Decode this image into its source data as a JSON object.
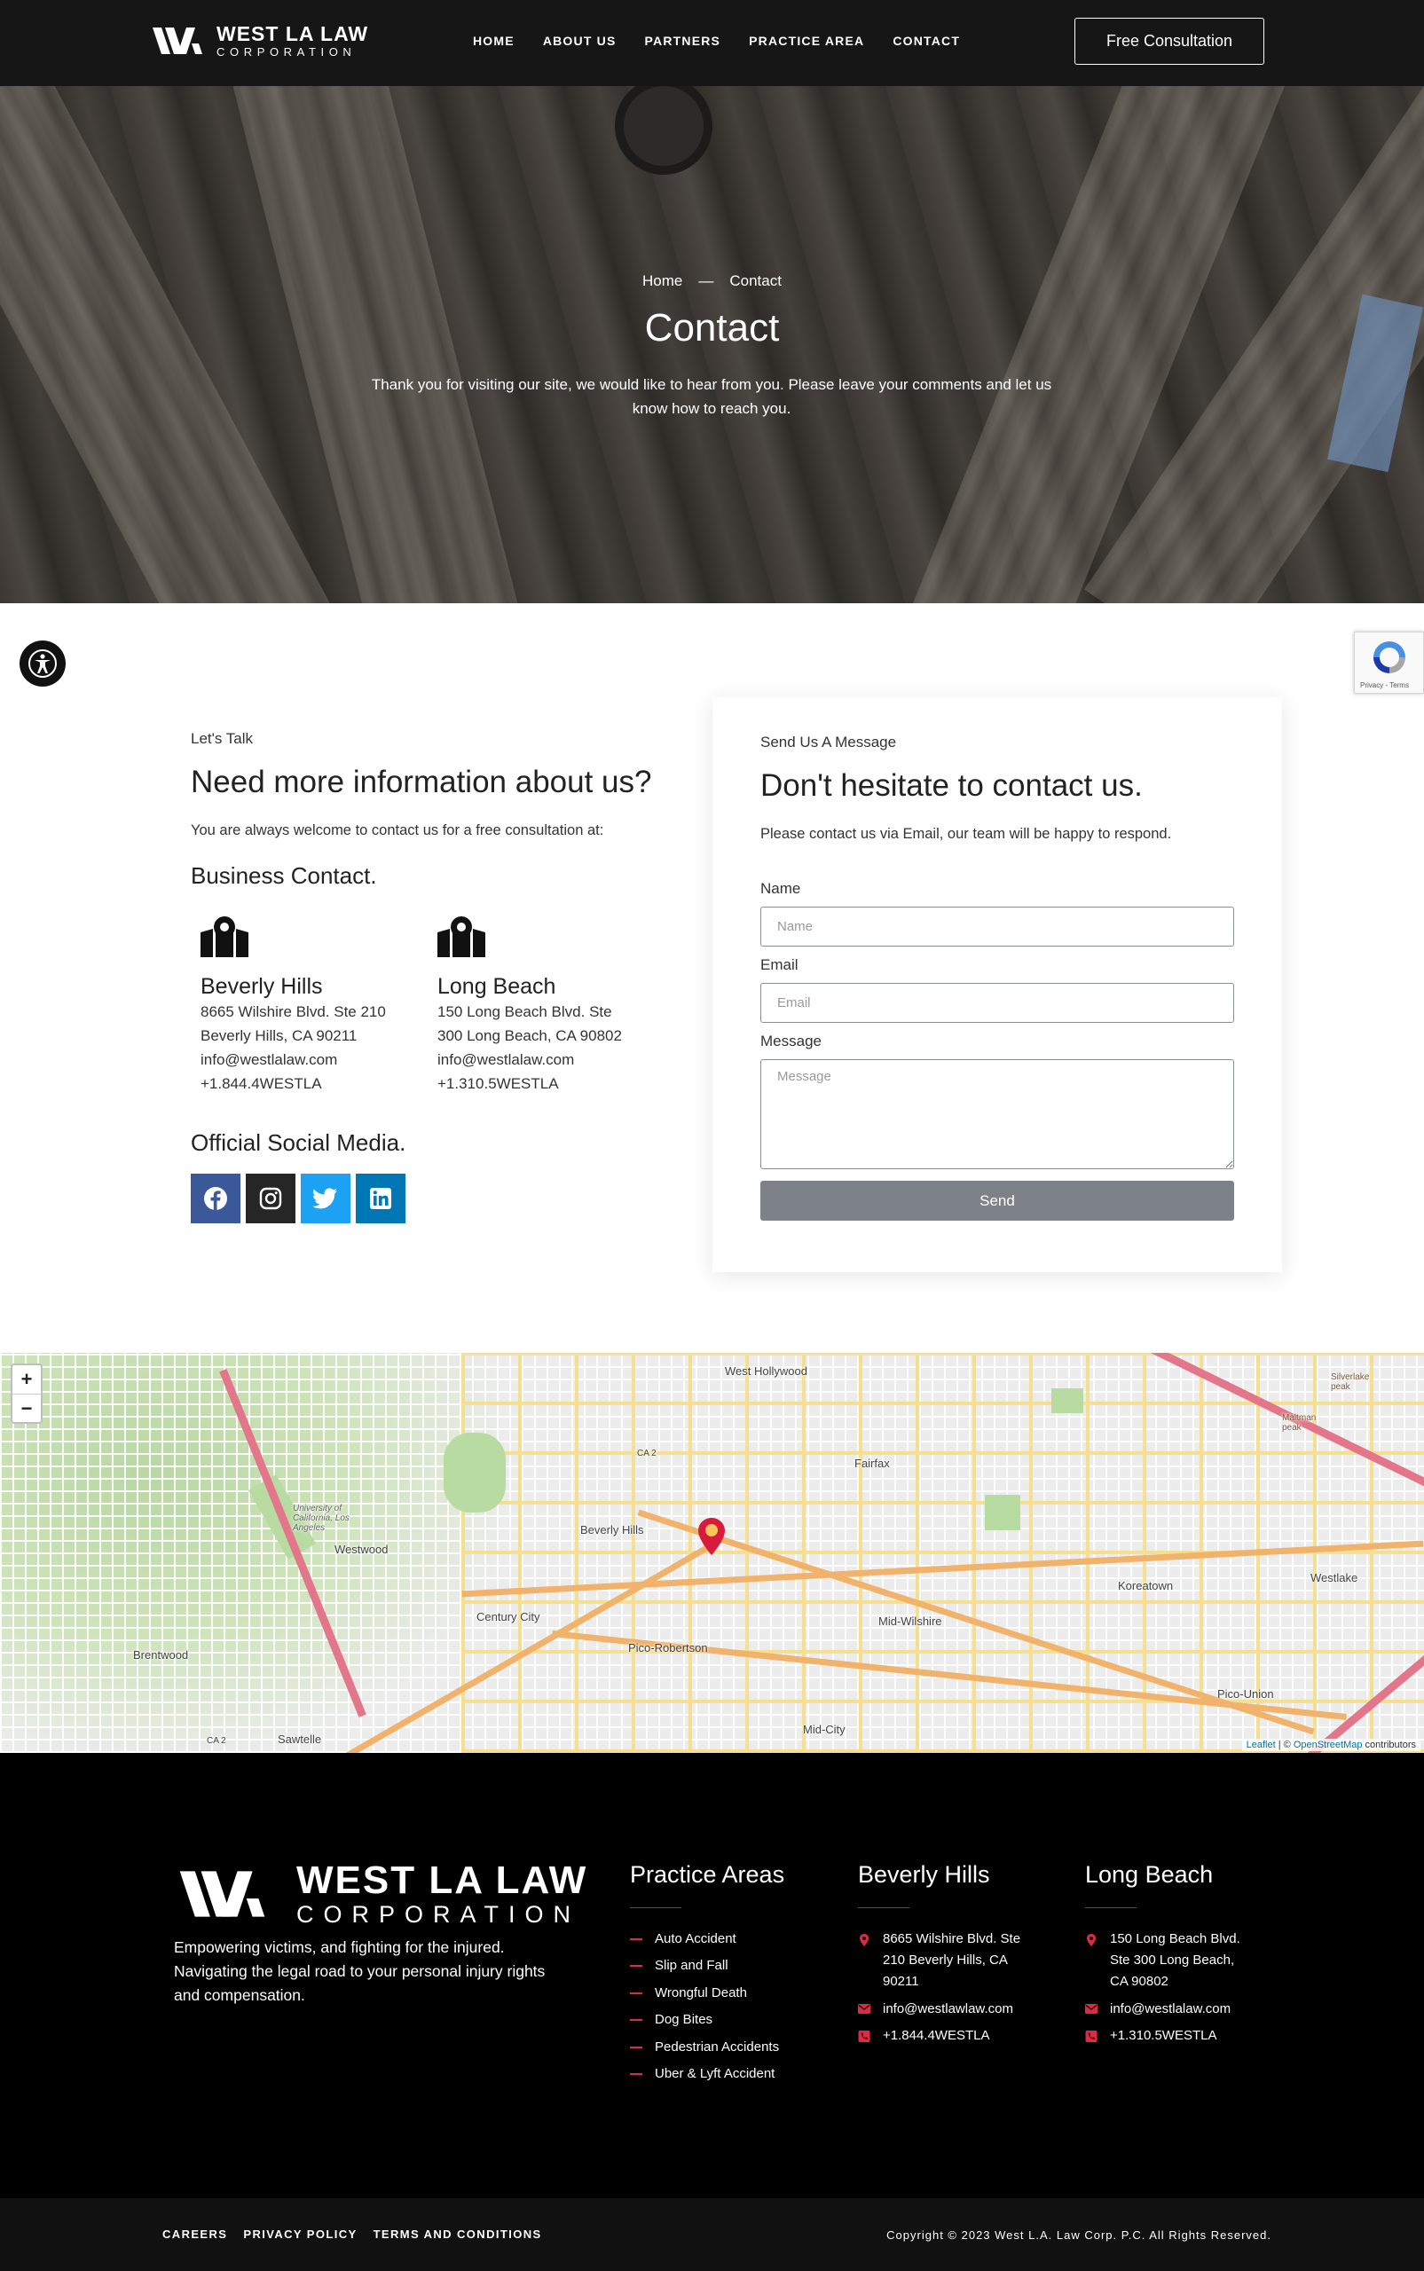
{
  "header": {
    "logo_line1": "WEST LA LAW",
    "logo_line2": "CORPORATION",
    "nav": [
      "HOME",
      "ABOUT US",
      "PARTNERS",
      "PRACTICE AREA",
      "CONTACT"
    ],
    "cta": "Free Consultation"
  },
  "hero": {
    "breadcrumb_home": "Home",
    "breadcrumb_sep": "—",
    "breadcrumb_current": "Contact",
    "title": "Contact",
    "subtitle": "Thank you for visiting our site, we would like to hear from you. Please leave your comments and let us know how to reach you."
  },
  "contact": {
    "eyebrow": "Let's Talk",
    "heading": "Need more information about us?",
    "lead": "You are always welcome to contact us for a free consultation at:",
    "business_heading": "Business Contact.",
    "offices": [
      {
        "name": "Beverly Hills",
        "address1": "8665 Wilshire Blvd. Ste 210",
        "address2": "Beverly Hills, CA 90211",
        "email": "info@westlalaw.com",
        "phone": "+1.844.4WESTLA"
      },
      {
        "name": "Long Beach",
        "address1": "150 Long Beach Blvd. Ste",
        "address2": "300 Long Beach, CA 90802",
        "email": "info@westlalaw.com",
        "phone": "+1.310.5WESTLA"
      }
    ],
    "social_heading": "Official Social Media.",
    "social": [
      "facebook-icon",
      "instagram-icon",
      "twitter-icon",
      "linkedin-icon"
    ]
  },
  "form": {
    "eyebrow": "Send Us A Message",
    "heading": "Don't hesitate to contact us.",
    "lead": "Please contact us via Email, our team will be happy to respond.",
    "name_label": "Name",
    "name_placeholder": "Name",
    "email_label": "Email",
    "email_placeholder": "Email",
    "message_label": "Message",
    "message_placeholder": "Message",
    "send_label": "Send"
  },
  "map": {
    "labels": [
      "West Hollywood",
      "Fairfax",
      "Beverly Hills",
      "Westwood",
      "University of California, Los Angeles",
      "Century City",
      "Pico-Robertson",
      "Mid-Wilshire",
      "Koreatown",
      "Westlake",
      "Brentwood",
      "Sawtelle",
      "Mid-City",
      "Pico-Union",
      "Silverlake peak",
      "Maltman peak"
    ],
    "road_labels": [
      "CA 2",
      "CA 2"
    ],
    "zoom_in": "+",
    "zoom_out": "−",
    "attribution_leaflet": "Leaflet",
    "attribution_sep": " | © ",
    "attribution_osm": "OpenStreetMap",
    "attribution_tail": " contributors"
  },
  "footer": {
    "logo_line1": "WEST LA LAW",
    "logo_line2": "CORPORATION",
    "tagline": "Empowering victims, and fighting for the injured. Navigating the legal road to your personal injury rights and compensation.",
    "practice_title": "Practice Areas",
    "practice_items": [
      "Auto Accident",
      "Slip and Fall",
      "Wrongful Death",
      "Dog Bites",
      "Pedestrian Accidents",
      "Uber & Lyft Accident"
    ],
    "bh_title": "Beverly Hills",
    "bh_address": "8665 Wilshire Blvd. Ste 210 Beverly Hills, CA 90211",
    "bh_email": "info@westlawlaw.com",
    "bh_phone": "+1.844.4WESTLA",
    "lb_title": "Long Beach",
    "lb_address": "150 Long Beach Blvd. Ste 300 Long Beach, CA 90802",
    "lb_email": "info@westlalaw.com",
    "lb_phone": "+1.310.5WESTLA",
    "accent": "#e02a43"
  },
  "bottom": {
    "links": [
      "CAREERS",
      "PRIVACY POLICY",
      "TERMS AND CONDITIONS"
    ],
    "copyright": "Copyright © 2023 West L.A. Law Corp. P.C. All Rights Reserved."
  },
  "widgets": {
    "recaptcha_text": "Privacy - Terms"
  }
}
